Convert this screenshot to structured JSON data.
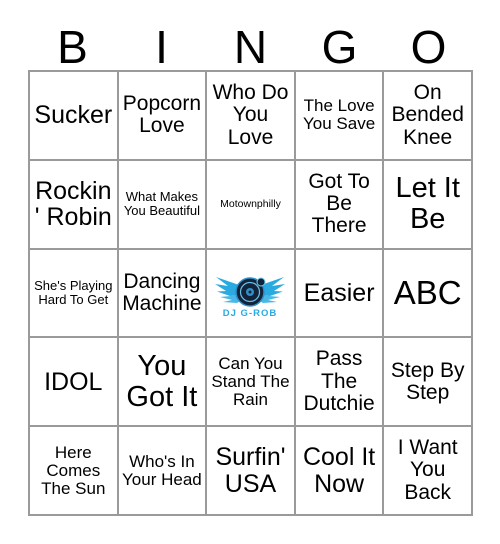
{
  "card": {
    "header_letters": [
      "B",
      "I",
      "N",
      "G",
      "O"
    ],
    "free_space": {
      "logo_name": "dj-g-rob-logo",
      "logo_text": "DJ G-ROB",
      "colors": {
        "wing_cyan": "#29abe2",
        "wing_light": "#6fd0f5",
        "record_dark": "#13233a",
        "record_ring": "#2f8fc9"
      }
    },
    "rows": [
      [
        {
          "text": "Sucker",
          "size": "lg"
        },
        {
          "text": "Popcorn Love",
          "size": "md"
        },
        {
          "text": "Who Do You Love",
          "size": "md"
        },
        {
          "text": "The Love You Save",
          "size": "sm"
        },
        {
          "text": "On Bended Knee",
          "size": "md"
        }
      ],
      [
        {
          "text": "Rockin' Robin",
          "size": "lg"
        },
        {
          "text": "What Makes You Beautiful",
          "size": "xs"
        },
        {
          "text": "Motownphilly",
          "size": "xxs"
        },
        {
          "text": "Got To Be There",
          "size": "md"
        },
        {
          "text": "Let It Be",
          "size": "xl"
        }
      ],
      [
        {
          "text": "She's Playing Hard To Get",
          "size": "xs"
        },
        {
          "text": "Dancing Machine",
          "size": "md"
        },
        {
          "text": "",
          "size": "md",
          "free": true
        },
        {
          "text": "Easier",
          "size": "lg"
        },
        {
          "text": "ABC",
          "size": "xxl"
        }
      ],
      [
        {
          "text": "IDOL",
          "size": "lg"
        },
        {
          "text": "You Got It",
          "size": "xl"
        },
        {
          "text": "Can You Stand The Rain",
          "size": "sm"
        },
        {
          "text": "Pass The Dutchie",
          "size": "md"
        },
        {
          "text": "Step By Step",
          "size": "md"
        }
      ],
      [
        {
          "text": "Here Comes The Sun",
          "size": "sm"
        },
        {
          "text": "Who's In Your Head",
          "size": "sm"
        },
        {
          "text": "Surfin' USA",
          "size": "lg"
        },
        {
          "text": "Cool It Now",
          "size": "lg"
        },
        {
          "text": "I Want You Back",
          "size": "md"
        }
      ]
    ]
  }
}
